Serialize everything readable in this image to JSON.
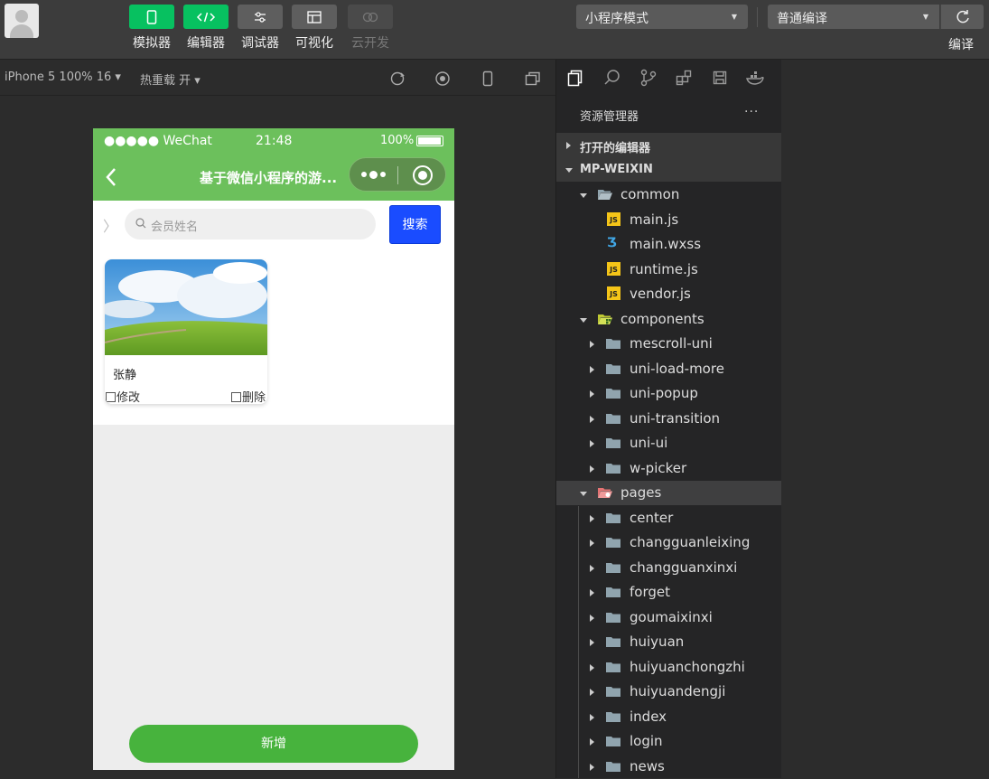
{
  "toolbar": {
    "buttons": [
      {
        "label": "模拟器",
        "icon": "phone-icon"
      },
      {
        "label": "编辑器",
        "icon": "code-icon"
      },
      {
        "label": "调试器",
        "icon": "sliders-icon"
      },
      {
        "label": "可视化",
        "icon": "layout-icon"
      },
      {
        "label": "云开发",
        "icon": "cloud-icon"
      }
    ],
    "mode_select": "小程序模式",
    "compile_select": "普通编译",
    "compile_label": "编译"
  },
  "simbar": {
    "device": "iPhone 5 100% 16",
    "hot_reload": "热重载 开"
  },
  "phone": {
    "carrier": "●●●●● WeChat",
    "time": "21:48",
    "battery": "100%",
    "title": "基于微信小程序的游...",
    "search_placeholder": "会员姓名",
    "search_button": "搜索",
    "card": {
      "name": "张静",
      "edit": "修改",
      "delete": "删除"
    },
    "add_button": "新增"
  },
  "explorer": {
    "title": "资源管理器",
    "more": "···",
    "open_editors": "打开的编辑器",
    "root": "MP-WEIXIN",
    "common": {
      "name": "common",
      "files": [
        {
          "name": "main.js",
          "type": "js"
        },
        {
          "name": "main.wxss",
          "type": "css"
        },
        {
          "name": "runtime.js",
          "type": "js"
        },
        {
          "name": "vendor.js",
          "type": "js"
        }
      ]
    },
    "components": {
      "name": "components",
      "folders": [
        "mescroll-uni",
        "uni-load-more",
        "uni-popup",
        "uni-transition",
        "uni-ui",
        "w-picker"
      ]
    },
    "pages": {
      "name": "pages",
      "folders": [
        "center",
        "changguanleixing",
        "changguanxinxi",
        "forget",
        "goumaixinxi",
        "huiyuan",
        "huiyuanchongzhi",
        "huiyuandengji",
        "index",
        "login",
        "news"
      ]
    }
  }
}
